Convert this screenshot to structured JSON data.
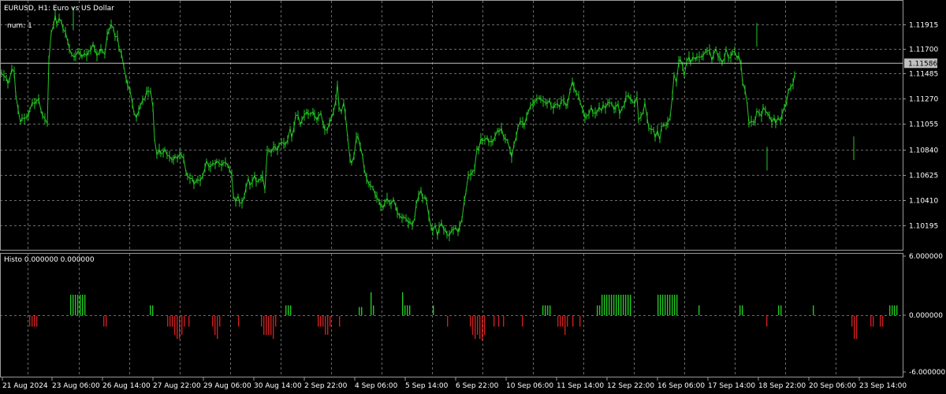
{
  "colors": {
    "background": "#000000",
    "grid": "#6b6b6b",
    "price_line": "#23c723",
    "hist_positive": "#22c722",
    "hist_negative": "#cc1f1f",
    "axis_text": "#ffffff",
    "current_price_label_bg": "#c0c0c0"
  },
  "header": {
    "title": "EURUSD, H1:  Euro vs US Dollar",
    "note": "num: 1"
  },
  "subwindow": {
    "title": "Histo 0.000000 0.000000"
  },
  "current_price": "1.11586",
  "chart_data": [
    {
      "type": "line",
      "name": "price",
      "y_ticks": [
        "1.11915",
        "1.11700",
        "1.11485",
        "1.11270",
        "1.11055",
        "1.10840",
        "1.10625",
        "1.10410",
        "1.10195"
      ],
      "ylim": [
        1.1,
        1.12125
      ],
      "x_ticks": [
        "21 Aug 2024",
        "23 Aug 06:00",
        "26 Aug 14:00",
        "27 Aug 22:00",
        "29 Aug 06:00",
        "30 Aug 14:00",
        "2 Sep 22:00",
        "4 Sep 06:00",
        "5 Sep 14:00",
        "6 Sep 22:00",
        "10 Sep 06:00",
        "11 Sep 14:00",
        "12 Sep 22:00",
        "16 Sep 06:00",
        "17 Sep 14:00",
        "18 Sep 22:00",
        "20 Sep 06:00",
        "23 Sep 14:00"
      ],
      "x": [
        0,
        2,
        5,
        8,
        10,
        12,
        15,
        18,
        20,
        23,
        26,
        28,
        31,
        34,
        36,
        38,
        41,
        44,
        46,
        49,
        52,
        54,
        57,
        60,
        62,
        65,
        68,
        70,
        72,
        75,
        78,
        80,
        83,
        86,
        88,
        91,
        94,
        96,
        99,
        102,
        104,
        107,
        110,
        112,
        115,
        118,
        120,
        123,
        126,
        128,
        130,
        133,
        136,
        138,
        141,
        144,
        146,
        149,
        151,
        154,
        157,
        160,
        162,
        165,
        168,
        170,
        173,
        176,
        178,
        181,
        184,
        186,
        188,
        191,
        194,
        196,
        199,
        202,
        204,
        207,
        209,
        212,
        215,
        218,
        220,
        222,
        225,
        228,
        230,
        233,
        236,
        238,
        241,
        244,
        246,
        249,
        251,
        254,
        257,
        260,
        262,
        265,
        267,
        270,
        273,
        275,
        278,
        281,
        283,
        286,
        289,
        291,
        294,
        296,
        299,
        302,
        304,
        307,
        310,
        312,
        315,
        317,
        320,
        323,
        325,
        328,
        331,
        333,
        336,
        339,
        341,
        344,
        347,
        349,
        352,
        354,
        357,
        360,
        362,
        365,
        368,
        370,
        373,
        375,
        378,
        381,
        383,
        386,
        389,
        391,
        394,
        397,
        399,
        402,
        404,
        407,
        410,
        412,
        415,
        418,
        420,
        423,
        426,
        428,
        430,
        433,
        436,
        438,
        441,
        444,
        446,
        449,
        452,
        454,
        457,
        460,
        462,
        465,
        468,
        470,
        473,
        476,
        478,
        481,
        483,
        486,
        488,
        491,
        494,
        496,
        499,
        502,
        504,
        507,
        510,
        512,
        515,
        518,
        520,
        523,
        526,
        528,
        531,
        534,
        536,
        539,
        541,
        544,
        547,
        549,
        552,
        555,
        557,
        560,
        563,
        565,
        567,
        570,
        573,
        575,
        578,
        581,
        583,
        586,
        589,
        591,
        594,
        597,
        599,
        602,
        605,
        607,
        610,
        612,
        615,
        618,
        620,
        623,
        625,
        628,
        631,
        633,
        636,
        639,
        641,
        644,
        647,
        649,
        652,
        655,
        657,
        660,
        663,
        665,
        668,
        670,
        673,
        676,
        678,
        681,
        684,
        686,
        689,
        692,
        694,
        697,
        699,
        702,
        704,
        707,
        710,
        712,
        715,
        718,
        720,
        723,
        726,
        728,
        731,
        734,
        736,
        739,
        742,
        744,
        747,
        750,
        752,
        755,
        757,
        760,
        763,
        765,
        768,
        771,
        773,
        776,
        779,
        781,
        784,
        786,
        789,
        792,
        794,
        797,
        800,
        802,
        805,
        808,
        810,
        813,
        816,
        818,
        821,
        823,
        826,
        829,
        831,
        834,
        837,
        839,
        842,
        845,
        847,
        850,
        853,
        855,
        858,
        861,
        863,
        866,
        868,
        871,
        874,
        876,
        879,
        882,
        884,
        887,
        890,
        892,
        895,
        897,
        900,
        903,
        905,
        908,
        911,
        913,
        916,
        919,
        921,
        924,
        927,
        929,
        932,
        935,
        937,
        940,
        942,
        945,
        948,
        950,
        953,
        956,
        958,
        960,
        963,
        966,
        968,
        971,
        974,
        976,
        979,
        982,
        984,
        987,
        990,
        992,
        995,
        998,
        1000,
        1003,
        1006,
        1008,
        1011,
        1014,
        1016,
        1019,
        1021,
        1024,
        1027,
        1029,
        1032,
        1035,
        1037,
        1040,
        1043,
        1045,
        1048,
        1051,
        1053,
        1056,
        1058,
        1061,
        1064,
        1066,
        1069,
        1072,
        1074,
        1077,
        1080,
        1082,
        1085,
        1088,
        1090,
        1093,
        1096,
        1098,
        1101,
        1104,
        1106,
        1109,
        1112,
        1114,
        1117,
        1119,
        1122,
        1125,
        1127,
        1130,
        1133,
        1135,
        1138,
        1141,
        1143,
        1146
      ],
      "y": [
        1.1151,
        1.115,
        1.1148,
        1.1146,
        1.1141,
        1.1144,
        1.1154,
        1.1151,
        1.1132,
        1.1119,
        1.1108,
        1.1112,
        1.1111,
        1.1113,
        1.1114,
        1.1119,
        1.1125,
        1.1124,
        1.1126,
        1.1128,
        1.1118,
        1.1114,
        1.1111,
        1.1107,
        1.1161,
        1.1185,
        1.1191,
        1.12,
        1.1192,
        1.1197,
        1.1194,
        1.1188,
        1.1185,
        1.1177,
        1.1171,
        1.1166,
        1.1164,
        1.1165,
        1.1169,
        1.1167,
        1.1164,
        1.1167,
        1.1165,
        1.1168,
        1.117,
        1.1175,
        1.1171,
        1.1165,
        1.1168,
        1.1171,
        1.1169,
        1.1166,
        1.1183,
        1.1186,
        1.1192,
        1.1188,
        1.1181,
        1.1182,
        1.1171,
        1.1167,
        1.1156,
        1.1145,
        1.114,
        1.1135,
        1.1124,
        1.1116,
        1.1112,
        1.1118,
        1.1122,
        1.1127,
        1.1128,
        1.1135,
        1.1134,
        1.1135,
        1.1121,
        1.1094,
        1.108,
        1.1085,
        1.1081,
        1.1082,
        1.1085,
        1.108,
        1.1079,
        1.1076,
        1.1076,
        1.1079,
        1.1077,
        1.1081,
        1.108,
        1.1077,
        1.1065,
        1.1062,
        1.106,
        1.106,
        1.1055,
        1.1058,
        1.1059,
        1.1058,
        1.1062,
        1.1069,
        1.1075,
        1.107,
        1.107,
        1.1073,
        1.1072,
        1.1075,
        1.1073,
        1.1071,
        1.1073,
        1.1074,
        1.1071,
        1.1068,
        1.1063,
        1.1045,
        1.104,
        1.1045,
        1.1039,
        1.1039,
        1.1045,
        1.1052,
        1.106,
        1.1054,
        1.1057,
        1.1063,
        1.1057,
        1.1058,
        1.106,
        1.1062,
        1.105,
        1.1084,
        1.1084,
        1.1082,
        1.1087,
        1.1087,
        1.1084,
        1.1089,
        1.1091,
        1.109,
        1.1089,
        1.1093,
        1.1103,
        1.1095,
        1.1104,
        1.1114,
        1.1114,
        1.1106,
        1.111,
        1.1114,
        1.1117,
        1.1115,
        1.1115,
        1.1117,
        1.1114,
        1.111,
        1.1113,
        1.1116,
        1.1106,
        1.1102,
        1.1101,
        1.1108,
        1.1111,
        1.1117,
        1.1127,
        1.1141,
        1.1121,
        1.1117,
        1.1125,
        1.1115,
        1.1095,
        1.1077,
        1.1073,
        1.1079,
        1.1095,
        1.1096,
        1.1087,
        1.1079,
        1.1068,
        1.106,
        1.1055,
        1.1054,
        1.1052,
        1.1046,
        1.1044,
        1.104,
        1.1036,
        1.1035,
        1.1039,
        1.1043,
        1.1039,
        1.1038,
        1.1042,
        1.1036,
        1.1031,
        1.1028,
        1.1026,
        1.1027,
        1.1026,
        1.1022,
        1.1023,
        1.102,
        1.1026,
        1.1038,
        1.1045,
        1.105,
        1.1043,
        1.1044,
        1.1041,
        1.1028,
        1.1018,
        1.1015,
        1.102,
        1.1011,
        1.1018,
        1.1022,
        1.1016,
        1.1016,
        1.1012,
        1.1011,
        1.1016,
        1.1016,
        1.1018,
        1.1014,
        1.1019,
        1.1025,
        1.1041,
        1.1048,
        1.1063,
        1.1063,
        1.1065,
        1.1068,
        1.1086,
        1.1084,
        1.1094,
        1.1092,
        1.1093,
        1.1095,
        1.1091,
        1.1092,
        1.1091,
        1.1096,
        1.1101,
        1.11,
        1.1103,
        1.1095,
        1.1094,
        1.1092,
        1.1084,
        1.1078,
        1.1089,
        1.1096,
        1.1104,
        1.1109,
        1.1108,
        1.1105,
        1.1113,
        1.1117,
        1.1122,
        1.1124,
        1.1125,
        1.1128,
        1.1129,
        1.1128,
        1.1126,
        1.1125,
        1.1124,
        1.1127,
        1.1122,
        1.112,
        1.1123,
        1.1124,
        1.1121,
        1.1127,
        1.1127,
        1.1122,
        1.1124,
        1.1135,
        1.1143,
        1.1138,
        1.1133,
        1.1131,
        1.1125,
        1.1119,
        1.1112,
        1.1113,
        1.1115,
        1.1121,
        1.1116,
        1.1116,
        1.1116,
        1.1121,
        1.1118,
        1.1123,
        1.112,
        1.1125,
        1.1125,
        1.1124,
        1.1119,
        1.1121,
        1.1124,
        1.1115,
        1.112,
        1.1123,
        1.113,
        1.1131,
        1.1128,
        1.1126,
        1.1124,
        1.113,
        1.111,
        1.1113,
        1.1117,
        1.1125,
        1.1112,
        1.1103,
        1.1102,
        1.1102,
        1.1095,
        1.1101,
        1.1093,
        1.1104,
        1.1106,
        1.1105,
        1.1108,
        1.1112,
        1.1131,
        1.1149,
        1.1142,
        1.116,
        1.1162,
        1.1156,
        1.1148,
        1.116,
        1.1164,
        1.1159,
        1.1164,
        1.1162,
        1.1164,
        1.1164,
        1.1164,
        1.1165,
        1.1169,
        1.1169,
        1.117,
        1.1161,
        1.1166,
        1.1171,
        1.1164,
        1.1164,
        1.1159,
        1.1163,
        1.1171,
        1.1163,
        1.1164,
        1.1168,
        1.1169,
        1.1163,
        1.1165,
        1.1157,
        1.1142,
        1.1136,
        1.1123,
        1.1107,
        1.1109,
        1.1108,
        1.1109,
        1.1118,
        1.1116,
        1.1113,
        1.1121,
        1.1118,
        1.1115,
        1.1114,
        1.1108,
        1.1112,
        1.1107,
        1.1112,
        1.1109,
        1.1115,
        1.1121,
        1.1126,
        1.1135,
        1.1138,
        1.1141,
        1.1149
      ],
      "price_highs": [
        [
          93,
          1.1207
        ],
        [
          960,
          1.1193
        ],
        [
          973,
          1.1087
        ],
        [
          1083,
          1.1096
        ]
      ]
    },
    {
      "type": "bar",
      "name": "histogram",
      "y_ticks": [
        "6.000000",
        "0.000000",
        "-6.000000"
      ],
      "ylim": [
        -6,
        6
      ],
      "bars": [
        [
          37,
          -1.3
        ],
        [
          40,
          -1.3
        ],
        [
          43,
          -1.3
        ],
        [
          46,
          -1.3
        ],
        [
          89,
          2.5
        ],
        [
          92,
          2.5
        ],
        [
          95,
          2.5
        ],
        [
          98,
          2.5
        ],
        [
          101,
          2.5
        ],
        [
          104,
          2.5
        ],
        [
          107,
          2.5
        ],
        [
          131,
          -1.3
        ],
        [
          134,
          -1.3
        ],
        [
          190,
          1.2
        ],
        [
          193,
          1.2
        ],
        [
          212,
          -1.3
        ],
        [
          215,
          -1.3
        ],
        [
          218,
          -1.3
        ],
        [
          221,
          -2.3
        ],
        [
          224,
          -2.8
        ],
        [
          227,
          -2.8
        ],
        [
          230,
          -2.3
        ],
        [
          233,
          -1.3
        ],
        [
          239,
          -1.3
        ],
        [
          269,
          -1.3
        ],
        [
          272,
          -2.3
        ],
        [
          275,
          -2.8
        ],
        [
          278,
          -1.3
        ],
        [
          302,
          -1.3
        ],
        [
          331,
          -1.3
        ],
        [
          334,
          -2.3
        ],
        [
          337,
          -2.3
        ],
        [
          340,
          -2.3
        ],
        [
          343,
          -2.3
        ],
        [
          346,
          -2.8
        ],
        [
          349,
          -1.3
        ],
        [
          362,
          1.2
        ],
        [
          365,
          1.2
        ],
        [
          368,
          1.2
        ],
        [
          403,
          -1.3
        ],
        [
          406,
          -1.3
        ],
        [
          409,
          -1.3
        ],
        [
          412,
          -2.3
        ],
        [
          415,
          -2.3
        ],
        [
          418,
          -1.3
        ],
        [
          430,
          -1.3
        ],
        [
          455,
          1.0
        ],
        [
          458,
          1.0
        ],
        [
          470,
          2.8
        ],
        [
          473,
          1.2
        ],
        [
          510,
          2.8
        ],
        [
          513,
          1.2
        ],
        [
          516,
          1.2
        ],
        [
          519,
          1.2
        ],
        [
          549,
          1.2
        ],
        [
          567,
          -1.3
        ],
        [
          596,
          -1.3
        ],
        [
          599,
          -2.3
        ],
        [
          602,
          -2.8
        ],
        [
          605,
          -2.3
        ],
        [
          608,
          -2.8
        ],
        [
          611,
          -3.0
        ],
        [
          614,
          -2.3
        ],
        [
          626,
          -1.3
        ],
        [
          632,
          -1.3
        ],
        [
          638,
          -1.3
        ],
        [
          662,
          -1.3
        ],
        [
          688,
          1.2
        ],
        [
          691,
          1.2
        ],
        [
          694,
          1.2
        ],
        [
          697,
          1.2
        ],
        [
          707,
          -1.3
        ],
        [
          710,
          -1.3
        ],
        [
          713,
          -1.3
        ],
        [
          716,
          -2.3
        ],
        [
          719,
          -1.3
        ],
        [
          726,
          -1.3
        ],
        [
          735,
          -1.3
        ],
        [
          757,
          1.2
        ],
        [
          760,
          1.2
        ],
        [
          763,
          2.5
        ],
        [
          766,
          2.5
        ],
        [
          769,
          2.5
        ],
        [
          772,
          2.5
        ],
        [
          775,
          2.5
        ],
        [
          778,
          2.5
        ],
        [
          781,
          2.5
        ],
        [
          784,
          2.5
        ],
        [
          787,
          2.5
        ],
        [
          790,
          2.5
        ],
        [
          793,
          2.5
        ],
        [
          796,
          2.5
        ],
        [
          799,
          2.5
        ],
        [
          834,
          2.5
        ],
        [
          837,
          2.5
        ],
        [
          840,
          2.5
        ],
        [
          843,
          2.5
        ],
        [
          846,
          2.5
        ],
        [
          849,
          2.5
        ],
        [
          852,
          2.5
        ],
        [
          855,
          2.5
        ],
        [
          858,
          2.5
        ],
        [
          886,
          1.2
        ],
        [
          938,
          1.2
        ],
        [
          941,
          1.2
        ],
        [
          972,
          -1.3
        ],
        [
          987,
          1.2
        ],
        [
          990,
          1.2
        ],
        [
          1031,
          1.2
        ],
        [
          1080,
          -1.3
        ],
        [
          1083,
          -2.8
        ],
        [
          1086,
          -2.8
        ],
        [
          1104,
          -1.3
        ],
        [
          1107,
          -1.3
        ],
        [
          1116,
          -1.3
        ],
        [
          1119,
          -1.3
        ],
        [
          1128,
          1.2
        ],
        [
          1131,
          1.2
        ],
        [
          1134,
          1.2
        ],
        [
          1137,
          1.2
        ]
      ]
    }
  ]
}
